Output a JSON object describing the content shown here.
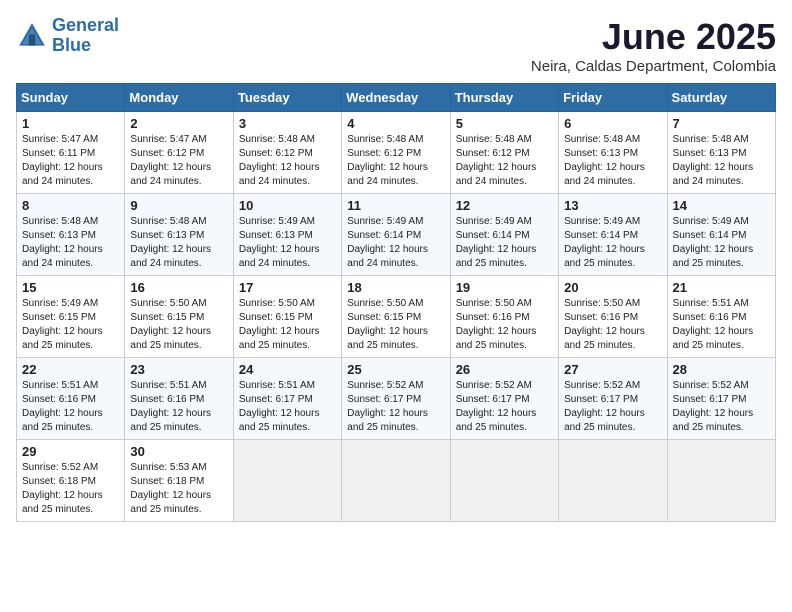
{
  "header": {
    "logo_line1": "General",
    "logo_line2": "Blue",
    "month": "June 2025",
    "location": "Neira, Caldas Department, Colombia"
  },
  "weekdays": [
    "Sunday",
    "Monday",
    "Tuesday",
    "Wednesday",
    "Thursday",
    "Friday",
    "Saturday"
  ],
  "weeks": [
    [
      {
        "day": "1",
        "info": "Sunrise: 5:47 AM\nSunset: 6:11 PM\nDaylight: 12 hours\nand 24 minutes."
      },
      {
        "day": "2",
        "info": "Sunrise: 5:47 AM\nSunset: 6:12 PM\nDaylight: 12 hours\nand 24 minutes."
      },
      {
        "day": "3",
        "info": "Sunrise: 5:48 AM\nSunset: 6:12 PM\nDaylight: 12 hours\nand 24 minutes."
      },
      {
        "day": "4",
        "info": "Sunrise: 5:48 AM\nSunset: 6:12 PM\nDaylight: 12 hours\nand 24 minutes."
      },
      {
        "day": "5",
        "info": "Sunrise: 5:48 AM\nSunset: 6:12 PM\nDaylight: 12 hours\nand 24 minutes."
      },
      {
        "day": "6",
        "info": "Sunrise: 5:48 AM\nSunset: 6:13 PM\nDaylight: 12 hours\nand 24 minutes."
      },
      {
        "day": "7",
        "info": "Sunrise: 5:48 AM\nSunset: 6:13 PM\nDaylight: 12 hours\nand 24 minutes."
      }
    ],
    [
      {
        "day": "8",
        "info": "Sunrise: 5:48 AM\nSunset: 6:13 PM\nDaylight: 12 hours\nand 24 minutes."
      },
      {
        "day": "9",
        "info": "Sunrise: 5:48 AM\nSunset: 6:13 PM\nDaylight: 12 hours\nand 24 minutes."
      },
      {
        "day": "10",
        "info": "Sunrise: 5:49 AM\nSunset: 6:13 PM\nDaylight: 12 hours\nand 24 minutes."
      },
      {
        "day": "11",
        "info": "Sunrise: 5:49 AM\nSunset: 6:14 PM\nDaylight: 12 hours\nand 24 minutes."
      },
      {
        "day": "12",
        "info": "Sunrise: 5:49 AM\nSunset: 6:14 PM\nDaylight: 12 hours\nand 25 minutes."
      },
      {
        "day": "13",
        "info": "Sunrise: 5:49 AM\nSunset: 6:14 PM\nDaylight: 12 hours\nand 25 minutes."
      },
      {
        "day": "14",
        "info": "Sunrise: 5:49 AM\nSunset: 6:14 PM\nDaylight: 12 hours\nand 25 minutes."
      }
    ],
    [
      {
        "day": "15",
        "info": "Sunrise: 5:49 AM\nSunset: 6:15 PM\nDaylight: 12 hours\nand 25 minutes."
      },
      {
        "day": "16",
        "info": "Sunrise: 5:50 AM\nSunset: 6:15 PM\nDaylight: 12 hours\nand 25 minutes."
      },
      {
        "day": "17",
        "info": "Sunrise: 5:50 AM\nSunset: 6:15 PM\nDaylight: 12 hours\nand 25 minutes."
      },
      {
        "day": "18",
        "info": "Sunrise: 5:50 AM\nSunset: 6:15 PM\nDaylight: 12 hours\nand 25 minutes."
      },
      {
        "day": "19",
        "info": "Sunrise: 5:50 AM\nSunset: 6:16 PM\nDaylight: 12 hours\nand 25 minutes."
      },
      {
        "day": "20",
        "info": "Sunrise: 5:50 AM\nSunset: 6:16 PM\nDaylight: 12 hours\nand 25 minutes."
      },
      {
        "day": "21",
        "info": "Sunrise: 5:51 AM\nSunset: 6:16 PM\nDaylight: 12 hours\nand 25 minutes."
      }
    ],
    [
      {
        "day": "22",
        "info": "Sunrise: 5:51 AM\nSunset: 6:16 PM\nDaylight: 12 hours\nand 25 minutes."
      },
      {
        "day": "23",
        "info": "Sunrise: 5:51 AM\nSunset: 6:16 PM\nDaylight: 12 hours\nand 25 minutes."
      },
      {
        "day": "24",
        "info": "Sunrise: 5:51 AM\nSunset: 6:17 PM\nDaylight: 12 hours\nand 25 minutes."
      },
      {
        "day": "25",
        "info": "Sunrise: 5:52 AM\nSunset: 6:17 PM\nDaylight: 12 hours\nand 25 minutes."
      },
      {
        "day": "26",
        "info": "Sunrise: 5:52 AM\nSunset: 6:17 PM\nDaylight: 12 hours\nand 25 minutes."
      },
      {
        "day": "27",
        "info": "Sunrise: 5:52 AM\nSunset: 6:17 PM\nDaylight: 12 hours\nand 25 minutes."
      },
      {
        "day": "28",
        "info": "Sunrise: 5:52 AM\nSunset: 6:17 PM\nDaylight: 12 hours\nand 25 minutes."
      }
    ],
    [
      {
        "day": "29",
        "info": "Sunrise: 5:52 AM\nSunset: 6:18 PM\nDaylight: 12 hours\nand 25 minutes."
      },
      {
        "day": "30",
        "info": "Sunrise: 5:53 AM\nSunset: 6:18 PM\nDaylight: 12 hours\nand 25 minutes."
      },
      {
        "day": "",
        "info": ""
      },
      {
        "day": "",
        "info": ""
      },
      {
        "day": "",
        "info": ""
      },
      {
        "day": "",
        "info": ""
      },
      {
        "day": "",
        "info": ""
      }
    ]
  ]
}
